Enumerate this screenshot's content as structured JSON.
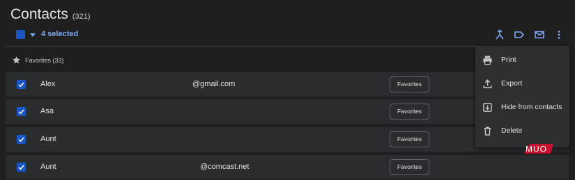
{
  "page": {
    "title": "Contacts",
    "count": "(321)"
  },
  "toolbar": {
    "selected_label": "4 selected",
    "icons": [
      "merge-icon",
      "label-icon",
      "email-icon",
      "more-vert-icon"
    ]
  },
  "favorites": {
    "label": "Favorites (33)"
  },
  "contacts": [
    {
      "name": "Alex",
      "email": "@gmail.com",
      "label": "Favorites",
      "checked": true
    },
    {
      "name": "Asa",
      "email": "",
      "label": "Favorites",
      "checked": true
    },
    {
      "name": "Aunt",
      "email": "",
      "label": "Favorites",
      "checked": true
    },
    {
      "name": "Aunt",
      "email": "@comcast.net",
      "label": "Favorites",
      "checked": true
    }
  ],
  "menu": {
    "items": [
      {
        "label": "Print",
        "icon": "print-icon"
      },
      {
        "label": "Export",
        "icon": "upload-icon"
      },
      {
        "label": "Hide from contacts",
        "icon": "hide-icon"
      },
      {
        "label": "Delete",
        "icon": "trash-icon"
      }
    ]
  },
  "watermark": {
    "text": "MUO"
  },
  "colors": {
    "background": "#1f1f1f",
    "row": "#2b2c2e",
    "accent": "#7cacf8",
    "checkbox": "#1a56c4",
    "watermark": "#c8102e"
  }
}
